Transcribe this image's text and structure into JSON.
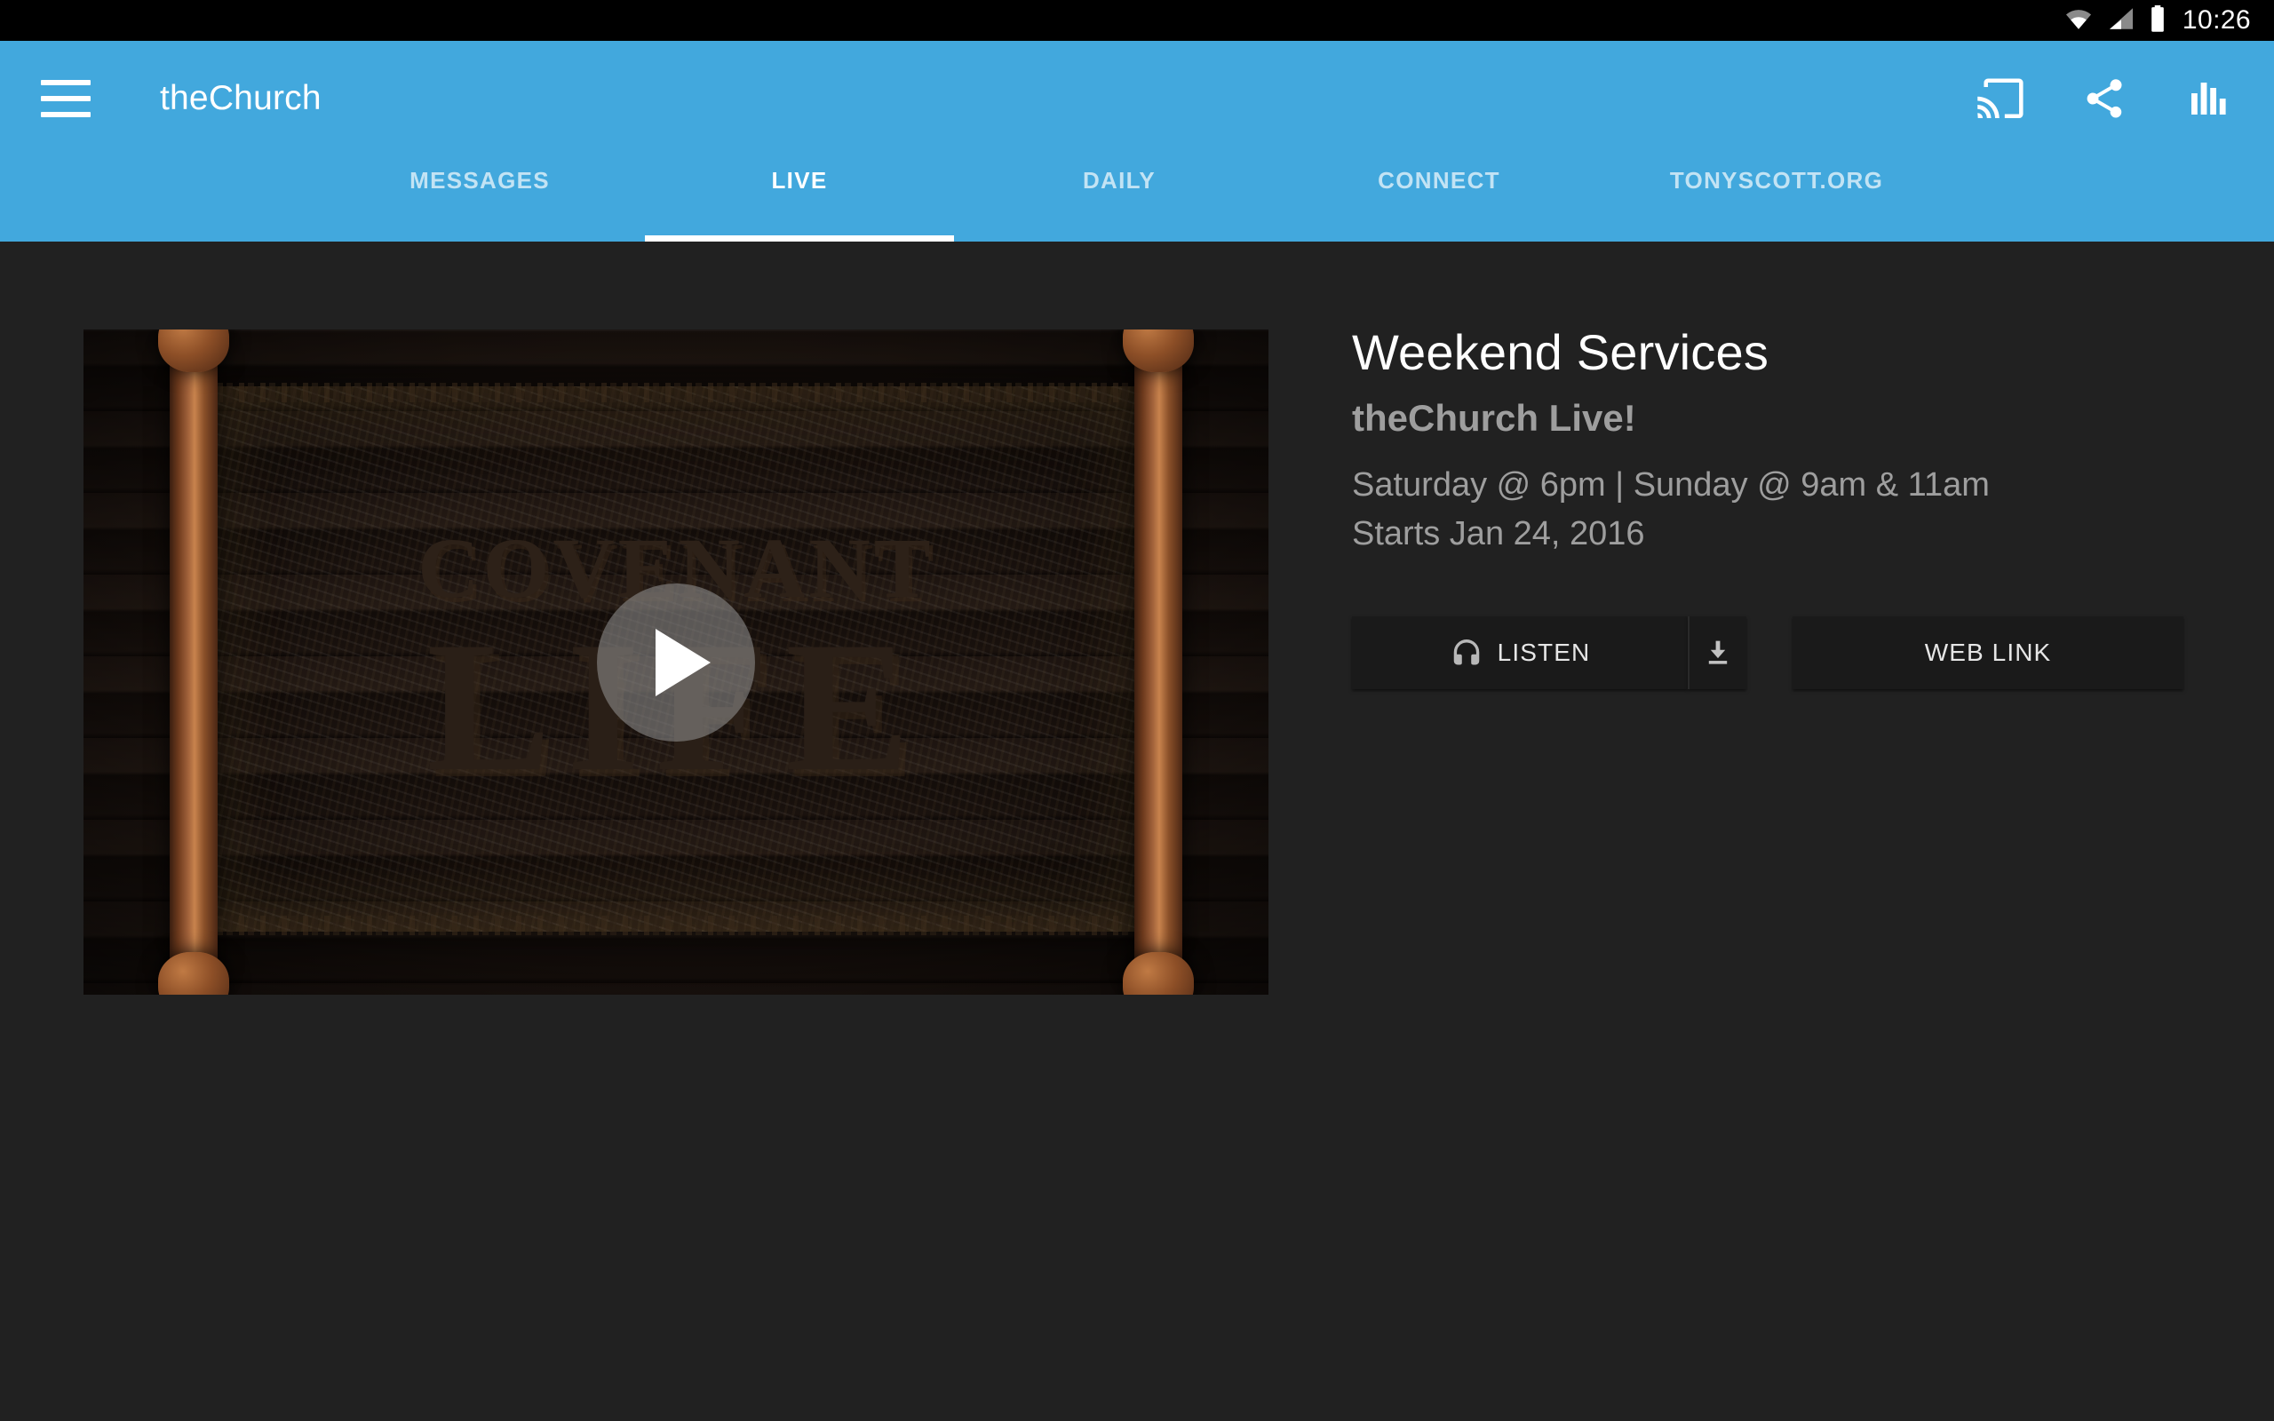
{
  "statusbar": {
    "time": "10:26",
    "icons": [
      "wifi-icon",
      "cellular-signal-icon",
      "battery-icon"
    ]
  },
  "appbar": {
    "menu_icon": "hamburger-menu-icon",
    "title": "theChurch",
    "background_color": "#42a8dd",
    "actions": [
      {
        "name": "cast-icon",
        "label": "Cast"
      },
      {
        "name": "share-icon",
        "label": "Share"
      },
      {
        "name": "equalizer-icon",
        "label": "Now Playing"
      }
    ]
  },
  "tabs": {
    "active_index": 1,
    "items": [
      {
        "label": "MESSAGES"
      },
      {
        "label": "LIVE"
      },
      {
        "label": "DAILY"
      },
      {
        "label": "CONNECT"
      },
      {
        "label": "TONYSCOTT.ORG"
      }
    ]
  },
  "video": {
    "alt": "Covenant Life scroll artwork",
    "artwork_line1": "COVENANT",
    "artwork_line2": "LIFE",
    "play_icon": "play-triangle-icon"
  },
  "details": {
    "title": "Weekend Services",
    "subtitle": "theChurch Live!",
    "schedule": "Saturday @ 6pm | Sunday @ 9am & 11am",
    "starts": "Starts Jan 24, 2016"
  },
  "buttons": {
    "listen": "LISTEN",
    "listen_icon": "headphones-icon",
    "download_icon": "download-icon",
    "weblink": "WEB LINK"
  },
  "colors": {
    "accent": "#42a8dd",
    "page_background": "#212121",
    "button_background": "#1a1a1a",
    "primary_text": "#ffffff",
    "secondary_text": "#9e9e9e"
  }
}
